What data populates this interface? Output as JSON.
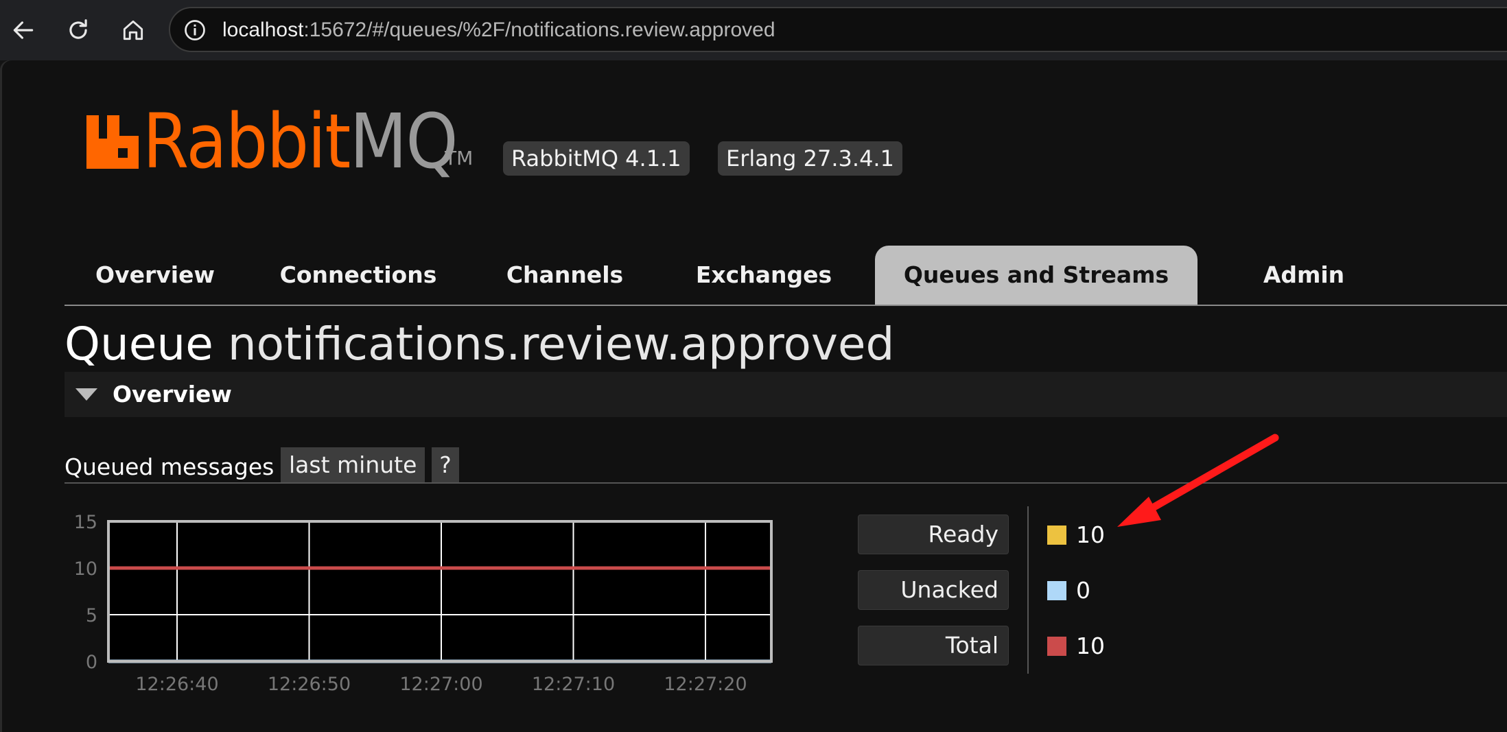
{
  "browser": {
    "url_host": "localhost",
    "url_path": ":15672/#/queues/%2F/notifications.review.approved"
  },
  "header": {
    "logo_rabbit": "Rabbit",
    "logo_mq": "MQ",
    "logo_tm": "TM",
    "version_rabbitmq": "RabbitMQ 4.1.1",
    "version_erlang": "Erlang 27.3.4.1"
  },
  "tabs": [
    {
      "label": "Overview",
      "active": false
    },
    {
      "label": "Connections",
      "active": false
    },
    {
      "label": "Channels",
      "active": false
    },
    {
      "label": "Exchanges",
      "active": false
    },
    {
      "label": "Queues and Streams",
      "active": true
    },
    {
      "label": "Admin",
      "active": false
    }
  ],
  "page": {
    "title_prefix": "Queue",
    "title_name": "notifications.review.approved"
  },
  "section": {
    "title": "Overview"
  },
  "queued_messages": {
    "label": "Queued messages",
    "range": "last minute",
    "help": "?"
  },
  "chart_data": {
    "type": "line",
    "x": [
      "12:26:40",
      "12:26:50",
      "12:27:00",
      "12:27:10",
      "12:27:20"
    ],
    "y_ticks": [
      "15",
      "10",
      "5",
      "0"
    ],
    "ylim": [
      0,
      15
    ],
    "grid": true,
    "series": [
      {
        "name": "Ready",
        "values": [
          10,
          10,
          10,
          10,
          10
        ],
        "color": "#edc240"
      },
      {
        "name": "Unacked",
        "values": [
          0,
          0,
          0,
          0,
          0
        ],
        "color": "#afd8f8"
      },
      {
        "name": "Total",
        "values": [
          10,
          10,
          10,
          10,
          10
        ],
        "color": "#cb4b4b"
      }
    ]
  },
  "legend": [
    {
      "label": "Ready",
      "value": "10",
      "color": "#edc240"
    },
    {
      "label": "Unacked",
      "value": "0",
      "color": "#afd8f8"
    },
    {
      "label": "Total",
      "value": "10",
      "color": "#cb4b4b"
    }
  ],
  "annotation": {
    "arrow_color": "#ff1a1a"
  }
}
